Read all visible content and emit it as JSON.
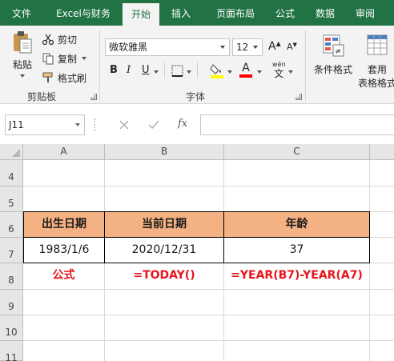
{
  "ribbon_tabs": [
    "文件",
    "Excel与财务",
    "开始",
    "插入",
    "页面布局",
    "公式",
    "数据",
    "审阅"
  ],
  "active_tab": "开始",
  "clipboard": {
    "paste": "粘贴",
    "cut": "剪切",
    "copy": "复制",
    "format_painter": "格式刷",
    "group_label": "剪贴板"
  },
  "font": {
    "name": "微软雅黑",
    "size": "12",
    "bold": "B",
    "italic": "I",
    "underline": "U",
    "font_color_letter": "A",
    "wen": "wén",
    "wen_char": "文",
    "group_label": "字体",
    "fill_color": "#ffff00",
    "text_color": "#ff0000"
  },
  "styles": {
    "conditional_format": "条件格式",
    "table_format_line1": "套用",
    "table_format_line2": "表格格式"
  },
  "formula_bar": {
    "name_box": "J11",
    "fx": "fx",
    "formula": ""
  },
  "columns": [
    "A",
    "B",
    "C"
  ],
  "rows": [
    "4",
    "5",
    "6",
    "7",
    "8",
    "9",
    "10",
    "11"
  ],
  "table": {
    "headers": [
      "出生日期",
      "当前日期",
      "年龄"
    ],
    "values": [
      "1983/1/6",
      "2020/12/31",
      "37"
    ],
    "formulas": [
      "公式",
      "=TODAY()",
      "=YEAR(B7)-YEAR(A7)"
    ],
    "header_fill": "#f4b183",
    "formula_color": "#e8141b"
  },
  "colors": {
    "brand": "#217346"
  }
}
